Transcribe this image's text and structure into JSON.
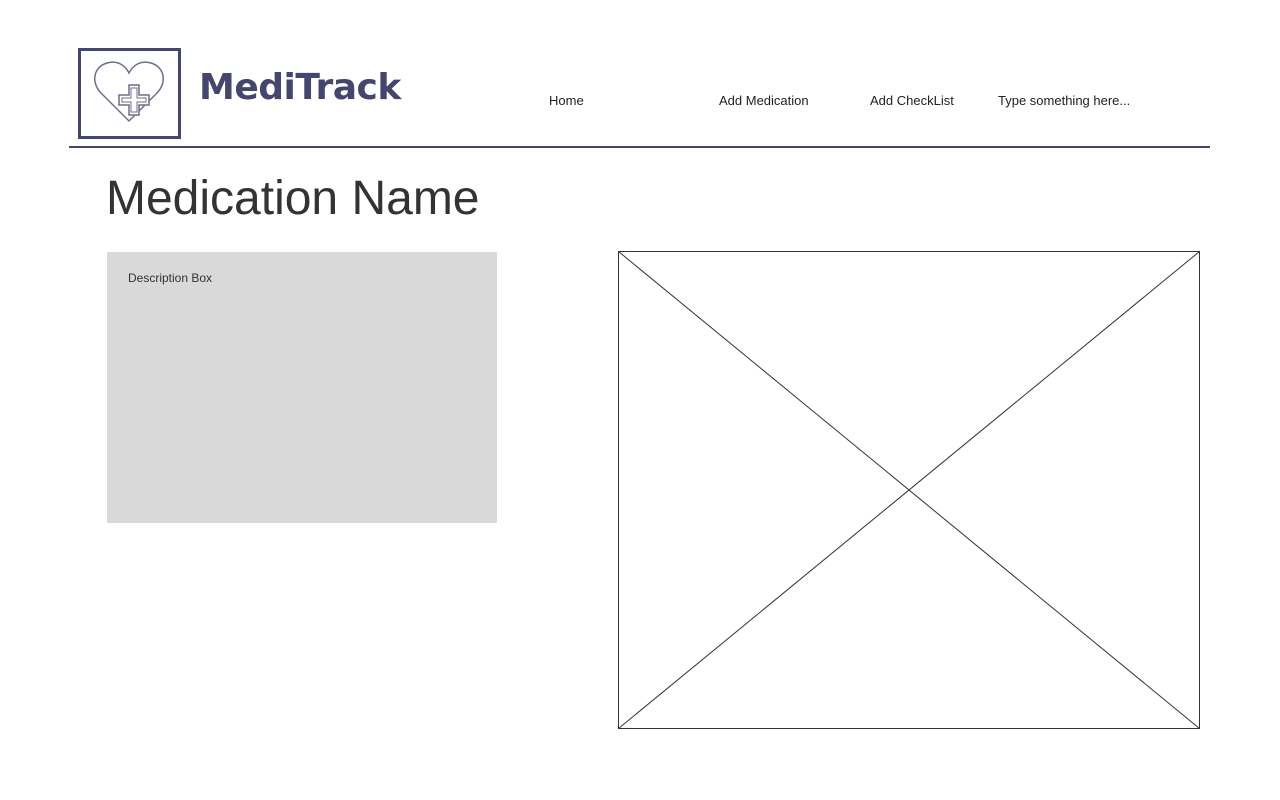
{
  "header": {
    "brand_name": "MediTrack",
    "logo_icon": "heart-plus-icon",
    "nav": {
      "home": "Home",
      "add_medication": "Add Medication",
      "add_checklist": "Add CheckList"
    },
    "search": {
      "placeholder": "Type something here...",
      "value": ""
    }
  },
  "main": {
    "title": "Medication Name",
    "description_label": "Description Box",
    "image_placeholder_icon": "image-placeholder-icon"
  },
  "colors": {
    "brand": "#45466d",
    "description_bg": "#d9d9d9",
    "text": "#333333"
  }
}
